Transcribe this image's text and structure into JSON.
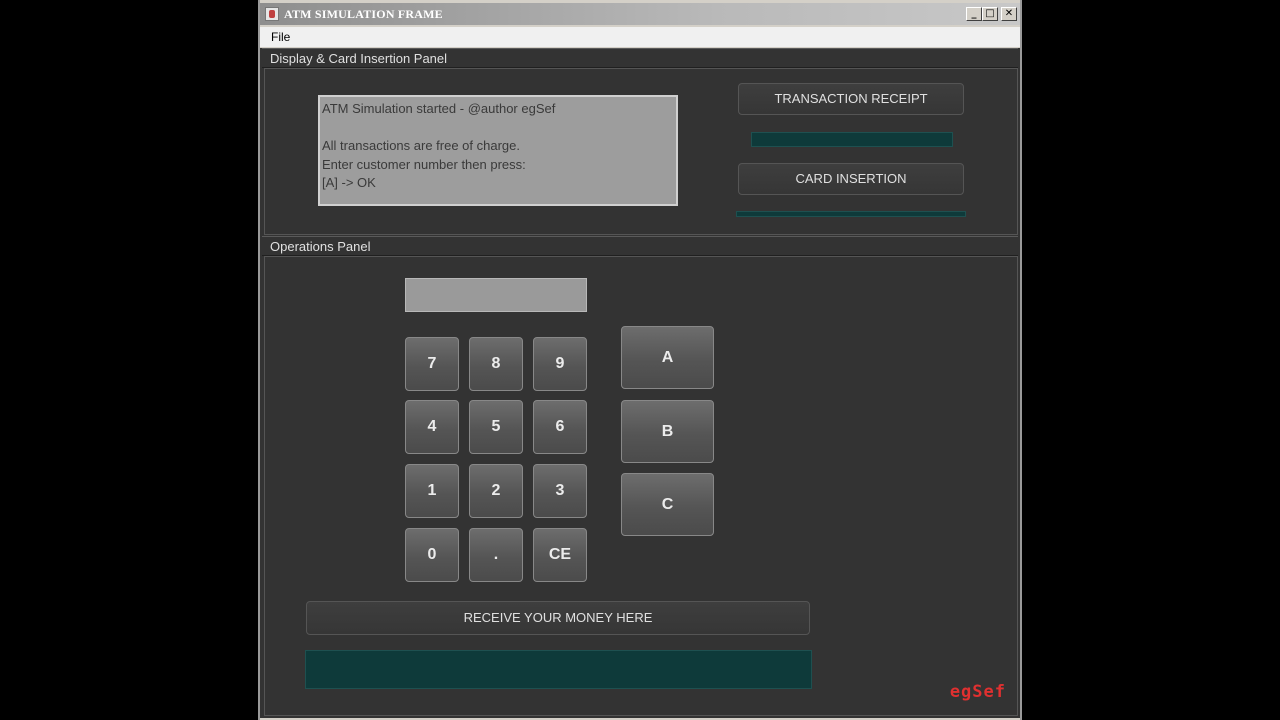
{
  "window": {
    "title": "ATM SIMULATION FRAME",
    "minimize": "_",
    "maximize": "□",
    "close": "✕"
  },
  "menu": {
    "file": "File"
  },
  "display_panel": {
    "title": "Display & Card Insertion Panel",
    "screen_text": "ATM Simulation started - @author egSef\n\nAll transactions are free of charge.\nEnter customer number then press:\n[A] -> OK",
    "receipt_button": "TRANSACTION RECEIPT",
    "card_button": "CARD INSERTION"
  },
  "operations_panel": {
    "title": "Operations Panel",
    "keypad": [
      "7",
      "8",
      "9",
      "4",
      "5",
      "6",
      "1",
      "2",
      "3",
      "0",
      ".",
      "CE"
    ],
    "function_keys": [
      "A",
      "B",
      "C"
    ],
    "money_button": "RECEIVE YOUR MONEY HERE"
  },
  "brand": "egSef",
  "colors": {
    "background": "#333333",
    "slot": "#0e3a3a",
    "brand": "#e03030"
  }
}
